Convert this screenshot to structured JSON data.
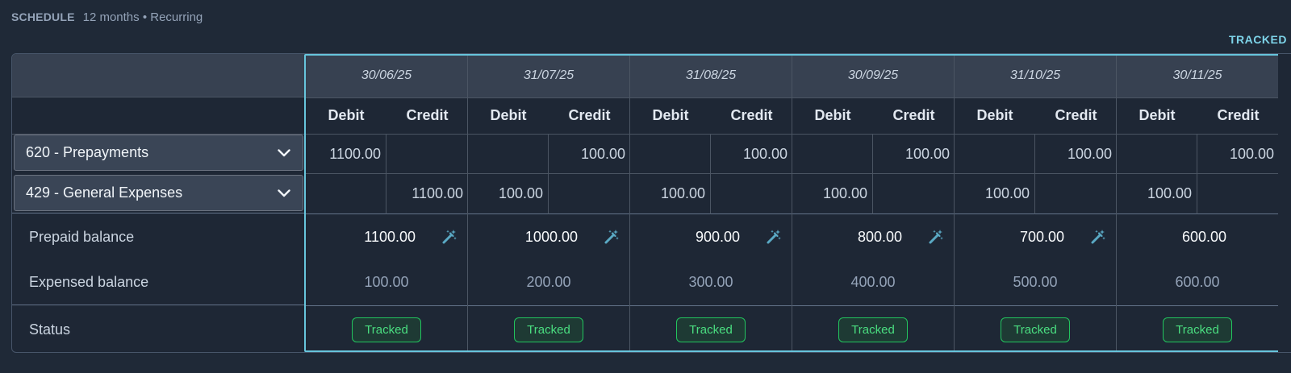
{
  "header": {
    "title": "SCHEDULE",
    "subtitle": "12 months • Recurring",
    "tracked_link": "TRACKED"
  },
  "accounts": [
    {
      "label": "620 - Prepayments"
    },
    {
      "label": "429 - General Expenses"
    }
  ],
  "row_labels": {
    "prepaid": "Prepaid balance",
    "expensed": "Expensed balance",
    "status": "Status"
  },
  "sub_headers": {
    "debit": "Debit",
    "credit": "Credit"
  },
  "columns": [
    {
      "date": "30/06/25",
      "r1_debit": "1100.00",
      "r1_credit": "",
      "r2_debit": "",
      "r2_credit": "1100.00",
      "prepaid": "1100.00",
      "expensed": "100.00",
      "status": "Tracked"
    },
    {
      "date": "31/07/25",
      "r1_debit": "",
      "r1_credit": "100.00",
      "r2_debit": "100.00",
      "r2_credit": "",
      "prepaid": "1000.00",
      "expensed": "200.00",
      "status": "Tracked"
    },
    {
      "date": "31/08/25",
      "r1_debit": "",
      "r1_credit": "100.00",
      "r2_debit": "100.00",
      "r2_credit": "",
      "prepaid": "900.00",
      "expensed": "300.00",
      "status": "Tracked"
    },
    {
      "date": "30/09/25",
      "r1_debit": "",
      "r1_credit": "100.00",
      "r2_debit": "100.00",
      "r2_credit": "",
      "prepaid": "800.00",
      "expensed": "400.00",
      "status": "Tracked"
    },
    {
      "date": "31/10/25",
      "r1_debit": "",
      "r1_credit": "100.00",
      "r2_debit": "100.00",
      "r2_credit": "",
      "prepaid": "700.00",
      "expensed": "500.00",
      "status": "Tracked"
    },
    {
      "date": "30/11/25",
      "r1_debit": "",
      "r1_credit": "100.00",
      "r2_debit": "100.00",
      "r2_credit": "",
      "prepaid": "600.00",
      "expensed": "600.00",
      "status": "Tracked"
    }
  ]
}
